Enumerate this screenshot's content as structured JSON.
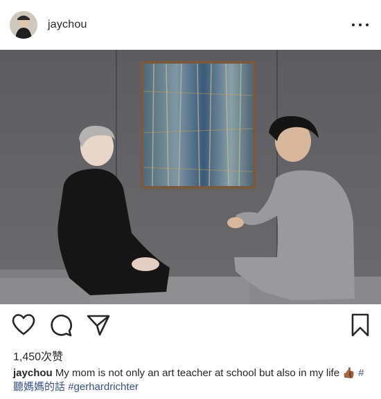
{
  "post": {
    "username": "jaychou",
    "likes": "1,450次赞",
    "caption": {
      "author": "jaychou",
      "text": "My mom is not only an art teacher at school but also in my life",
      "emoji": "👍🏾",
      "hashtags": [
        "#聽媽媽的話",
        "#gerhardrichter"
      ]
    }
  },
  "icons": {
    "avatar": "profile-avatar",
    "more": "more-options-icon",
    "like": "heart-icon",
    "comment": "comment-icon",
    "share": "direct-share-icon",
    "save": "bookmark-icon"
  },
  "colors": {
    "text": "#262626",
    "hashtag": "#385185",
    "background": "#ffffff"
  }
}
